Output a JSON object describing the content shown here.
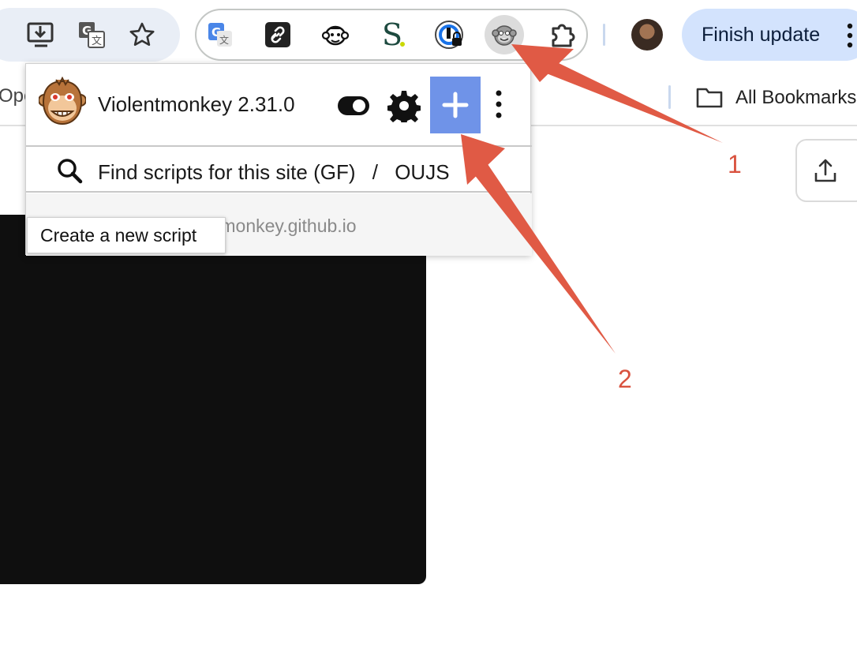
{
  "toolbar": {
    "icons": [
      "install-app-icon",
      "translate-icon",
      "bookmark-star-icon"
    ],
    "extensions": [
      "google-translate-icon",
      "link-extension-icon",
      "mailchimp-monkey-icon",
      "s-extension-icon",
      "password-manager-lock-icon",
      "violentmonkey-icon",
      "puzzle-extensions-icon"
    ],
    "finish_update_label": "Finish update"
  },
  "bookmarks": {
    "left_cut_text": "Ope",
    "all_bookmarks_label": "All Bookmarks"
  },
  "popup": {
    "title": "Violentmonkey 2.31.0",
    "find_scripts_label": "Find scripts for this site (GF)",
    "separator": "/",
    "oujs_label": "OUJS",
    "footer_link": "tmonkey.github.io",
    "tooltip": "Create a new script"
  },
  "annotations": {
    "label_1": "1",
    "label_2": "2",
    "color": "#d9523f"
  }
}
